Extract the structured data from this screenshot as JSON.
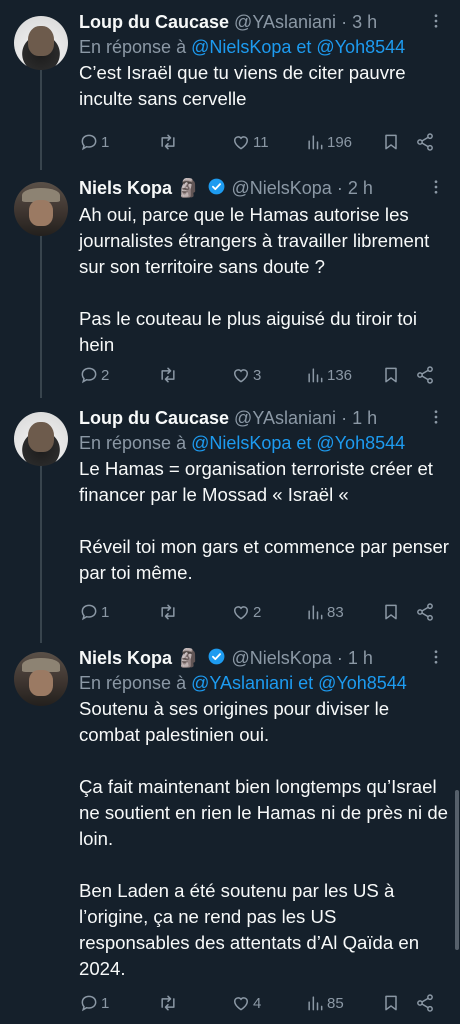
{
  "tweets": [
    {
      "name": "Loup du Caucase",
      "handle": "@YAslaniani",
      "time": "3 h",
      "reply_prefix": "En réponse à",
      "reply_to": "@NielsKopa et @Yoh8544",
      "paragraphs": [
        "C’est Israël que tu viens de citer pauvre inculte sans cervelle"
      ],
      "replies": "1",
      "retweets": "",
      "likes": "11",
      "views": "196"
    },
    {
      "name": "Niels Kopa",
      "emoji": "🗿",
      "verified": true,
      "handle": "@NielsKopa",
      "time": "2 h",
      "paragraphs": [
        "Ah oui, parce que le Hamas autorise les journalistes étrangers à travailler librement sur son territoire sans doute ?",
        "Pas le couteau le plus aiguisé du tiroir toi hein"
      ],
      "replies": "2",
      "retweets": "",
      "likes": "3",
      "views": "136"
    },
    {
      "name": "Loup du Caucase",
      "handle": "@YAslaniani",
      "time": "1 h",
      "reply_prefix": "En réponse à",
      "reply_to": "@NielsKopa et @Yoh8544",
      "paragraphs": [
        "Le Hamas = organisation terroriste créer et financer par le Mossad « Israël «",
        "Réveil toi mon gars et commence par penser par toi même."
      ],
      "replies": "1",
      "retweets": "",
      "likes": "2",
      "views": "83"
    },
    {
      "name": "Niels Kopa",
      "emoji": "🗿",
      "verified": true,
      "handle": "@NielsKopa",
      "time": "1 h",
      "reply_prefix": "En réponse à",
      "reply_to": "@YAslaniani et @Yoh8544",
      "paragraphs": [
        "Soutenu à ses origines pour diviser le combat palestinien oui.",
        "Ça fait maintenant bien longtemps qu’Israel ne soutient en rien le Hamas ni de près ni de loin.",
        "Ben Laden a été soutenu par les US à l’origine, ça ne rend pas les US responsables des attentats d’Al Qaïda en 2024."
      ],
      "replies": "1",
      "retweets": "",
      "likes": "4",
      "views": "85"
    }
  ],
  "colors": {
    "background": "#15202b",
    "text": "#f7f9f9",
    "muted": "#8b98a5",
    "link": "#1d9bf0"
  },
  "icons": [
    "reply-icon",
    "retweet-icon",
    "like-icon",
    "views-icon",
    "bookmark-icon",
    "share-icon",
    "more-icon",
    "verified-badge-icon"
  ]
}
